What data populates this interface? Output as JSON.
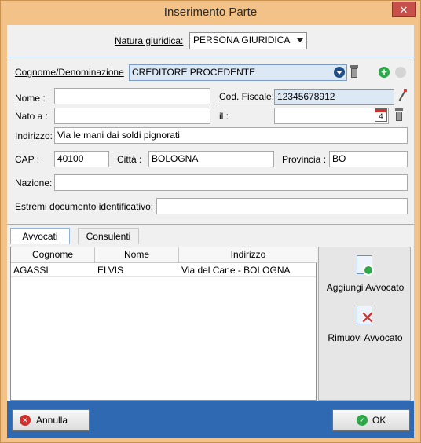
{
  "window": {
    "title": "Inserimento Parte",
    "close_glyph": "✕"
  },
  "natura": {
    "label": "Natura giuridica:",
    "value": "PERSONA GIURIDICA"
  },
  "form": {
    "cognome_label": "Cognome/Denominazione",
    "cognome_value": "CREDITORE PROCEDENTE",
    "nome_label": "Nome :",
    "nome_value": "",
    "cf_label": "Cod. Fiscale:",
    "cf_value": "12345678912",
    "nato_label": "Nato a :",
    "nato_value": "",
    "il_label": "il :",
    "il_value": "",
    "calendar_day": "4",
    "indirizzo_label": "Indirizzo:",
    "indirizzo_value": "Via le mani dai soldi pignorati",
    "cap_label": "CAP :",
    "cap_value": "40100",
    "citta_label": "Città :",
    "citta_value": "BOLOGNA",
    "provincia_label": "Provincia :",
    "provincia_value": "BO",
    "nazione_label": "Nazione:",
    "nazione_value": "",
    "documento_label": "Estremi documento identificativo:",
    "documento_value": ""
  },
  "tabs": [
    {
      "label": "Avvocati",
      "active": true
    },
    {
      "label": "Consulenti",
      "active": false
    }
  ],
  "table": {
    "columns": [
      "Cognome",
      "Nome",
      "Indirizzo"
    ],
    "rows": [
      [
        "AGASSI",
        "ELVIS",
        "Via del Cane - BOLOGNA"
      ]
    ]
  },
  "side": {
    "add_label": "Aggiungi Avvocato",
    "remove_label": "Rimuovi Avvocato"
  },
  "footer": {
    "cancel_label": "Annulla",
    "ok_label": "OK"
  },
  "colors": {
    "title_bar": "#f2c289",
    "footer": "#2f69b1",
    "accent_blue": "#8fb4dc",
    "add_green": "#2ea84a",
    "cancel_red": "#d0312d"
  }
}
